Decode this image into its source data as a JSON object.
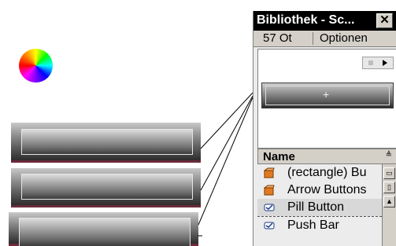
{
  "panel": {
    "title": "Bibliothek - Sc...",
    "close_glyph": "✕",
    "menu": {
      "count_label": "57 Ot",
      "options_label": "Optionen"
    },
    "preview": {
      "plus_glyph": "+"
    },
    "list_header": {
      "name_label": "Name",
      "sort_glyph": "≜"
    },
    "items": [
      {
        "label": "(rectangle) Bu",
        "icon": "graphic-symbol-icon"
      },
      {
        "label": "Arrow Buttons",
        "icon": "graphic-symbol-icon"
      },
      {
        "label": "Pill Button",
        "icon": "button-symbol-icon"
      },
      {
        "label": "Push Bar",
        "icon": "button-symbol-icon"
      }
    ]
  },
  "colors": {
    "panel_bg": "#ececec",
    "titlebar_bg": "#000000",
    "strip_accent": "#6b2a3a"
  }
}
